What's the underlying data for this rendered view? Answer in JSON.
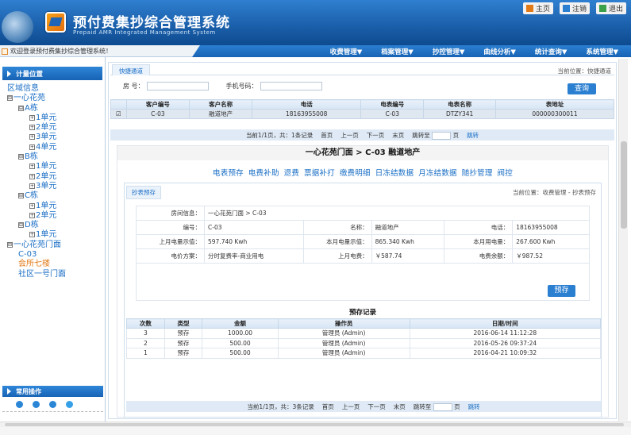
{
  "header": {
    "title": "预付费集抄综合管理系统",
    "subtitle": "Prepaid AMR Integrated Management System",
    "links": [
      "主页",
      "注销",
      "退出"
    ]
  },
  "welcome": "欢迎登录预付费集抄综合管理系统！",
  "menu": [
    "收费管理▼",
    "档案管理▼",
    "抄控管理▼",
    "曲线分析▼",
    "统计查询▼",
    "系统管理▼"
  ],
  "sidebar": {
    "title": "计量位置",
    "tree": [
      {
        "label": "区域信息",
        "level": 0,
        "toggle": ""
      },
      {
        "label": "一心花苑",
        "level": 0,
        "toggle": "⊟"
      },
      {
        "label": "A栋",
        "level": 1,
        "toggle": "⊟"
      },
      {
        "label": "1单元",
        "level": 2,
        "toggle": "+"
      },
      {
        "label": "2单元",
        "level": 2,
        "toggle": "+"
      },
      {
        "label": "3单元",
        "level": 2,
        "toggle": "+"
      },
      {
        "label": "4单元",
        "level": 2,
        "toggle": "+"
      },
      {
        "label": "B栋",
        "level": 1,
        "toggle": "⊟"
      },
      {
        "label": "1单元",
        "level": 2,
        "toggle": "+"
      },
      {
        "label": "2单元",
        "level": 2,
        "toggle": "+"
      },
      {
        "label": "3单元",
        "level": 2,
        "toggle": "+"
      },
      {
        "label": "C栋",
        "level": 1,
        "toggle": "⊟"
      },
      {
        "label": "1单元",
        "level": 2,
        "toggle": "+"
      },
      {
        "label": "2单元",
        "level": 2,
        "toggle": "+"
      },
      {
        "label": "D栋",
        "level": 1,
        "toggle": "⊟"
      },
      {
        "label": "1单元",
        "level": 2,
        "toggle": "+"
      },
      {
        "label": "一心花苑门面",
        "level": 0,
        "toggle": "⊟"
      },
      {
        "label": "C-03",
        "level": 1,
        "toggle": ""
      },
      {
        "label": "会所七楼",
        "level": 1,
        "toggle": "",
        "highlight": true
      },
      {
        "label": "社区一号门面",
        "level": 1,
        "toggle": ""
      }
    ],
    "common_ops": "常用操作"
  },
  "quick": {
    "tab": "快捷通道",
    "crumb": "当前位置：快捷通道",
    "room_label": "房  号：",
    "phone_label": "手机号码：",
    "query_button": "查询",
    "columns": [
      "",
      "客户编号",
      "客户名称",
      "电话",
      "电表编号",
      "电表名称",
      "表地址"
    ],
    "rows": [
      [
        "☑",
        "C-03",
        "融道地产",
        "18163955008",
        "C-03",
        "DTZY341",
        "000000300011"
      ]
    ],
    "pager": {
      "info": "当前1/1页，共：1条记录",
      "first": "首页",
      "prev": "上一页",
      "next": "下一页",
      "last": "末页",
      "jump": "跳转至",
      "page": "页",
      "go": "跳转"
    }
  },
  "detail": {
    "title": "一心花苑门面 > C-03   融道地产",
    "functions": [
      "电表预存",
      "电费补助",
      "退费",
      "票据补打",
      "缴费明细",
      "日冻结数据",
      "月冻结数据",
      "随抄管理",
      "阀控"
    ],
    "tab": "抄表预存",
    "crumb": "当前位置：收费管理 - 抄表预存",
    "info": {
      "room_label": "房间信息：",
      "room_value": "一心花苑门面 > C-03",
      "no_label": "编号：",
      "no_value": "C-03",
      "name_label": "名称：",
      "name_value": "融道地产",
      "tel_label": "电话：",
      "tel_value": "18163955008",
      "last_reading_label": "上月电量示值：",
      "last_reading_value": "597.740 Kwh",
      "cur_reading_label": "本月电量示值：",
      "cur_reading_value": "865.340 Kwh",
      "usage_label": "本月用电量：",
      "usage_value": "267.600 Kwh",
      "plan_label": "电价方案：",
      "plan_value": "分时复费率-商业用电",
      "last_fee_label": "上月电费：",
      "last_fee_value": "￥587.74",
      "balance_label": "电费余额：",
      "balance_value": "￥987.52"
    },
    "prestore_button": "预存",
    "records_title": "预存记录",
    "record_columns": [
      "次数",
      "类型",
      "金额",
      "操作员",
      "日期/时间"
    ],
    "records": [
      [
        "3",
        "预存",
        "1000.00",
        "管理员 (Admin)",
        "2016-06-14 11:12:28"
      ],
      [
        "2",
        "预存",
        "500.00",
        "管理员 (Admin)",
        "2016-05-26 09:37:24"
      ],
      [
        "1",
        "预存",
        "500.00",
        "管理员 (Admin)",
        "2016-04-21 10:09:32"
      ]
    ],
    "pager": {
      "info": "当前1/1页，共：3条记录",
      "first": "首页",
      "prev": "上一页",
      "next": "下一页",
      "last": "末页",
      "jump": "跳转至",
      "page": "页",
      "go": "跳转"
    }
  }
}
